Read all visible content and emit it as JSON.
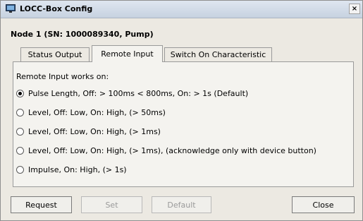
{
  "window": {
    "title": "LOCC-Box Config",
    "close_label": "×"
  },
  "node_title": "Node 1 (SN: 1000089340, Pump)",
  "tabs": [
    {
      "label": "Status Output",
      "active": false
    },
    {
      "label": "Remote Input",
      "active": true
    },
    {
      "label": "Switch On Characteristic",
      "active": false
    }
  ],
  "remote_input": {
    "group_label": "Remote Input works on:",
    "options": [
      {
        "label": "Pulse Length, Off: > 100ms < 800ms, On: > 1s (Default)",
        "selected": true
      },
      {
        "label": "Level, Off: Low, On: High, (> 50ms)",
        "selected": false
      },
      {
        "label": "Level, Off: Low, On: High, (> 1ms)",
        "selected": false
      },
      {
        "label": "Level, Off: Low, On: High, (> 1ms), (acknowledge only with device button)",
        "selected": false
      },
      {
        "label": "Impulse, On: High, (> 1s)",
        "selected": false
      }
    ]
  },
  "buttons": {
    "request": "Request",
    "set": "Set",
    "default": "Default",
    "close": "Close"
  },
  "icons": {
    "app": "monitor-icon"
  }
}
